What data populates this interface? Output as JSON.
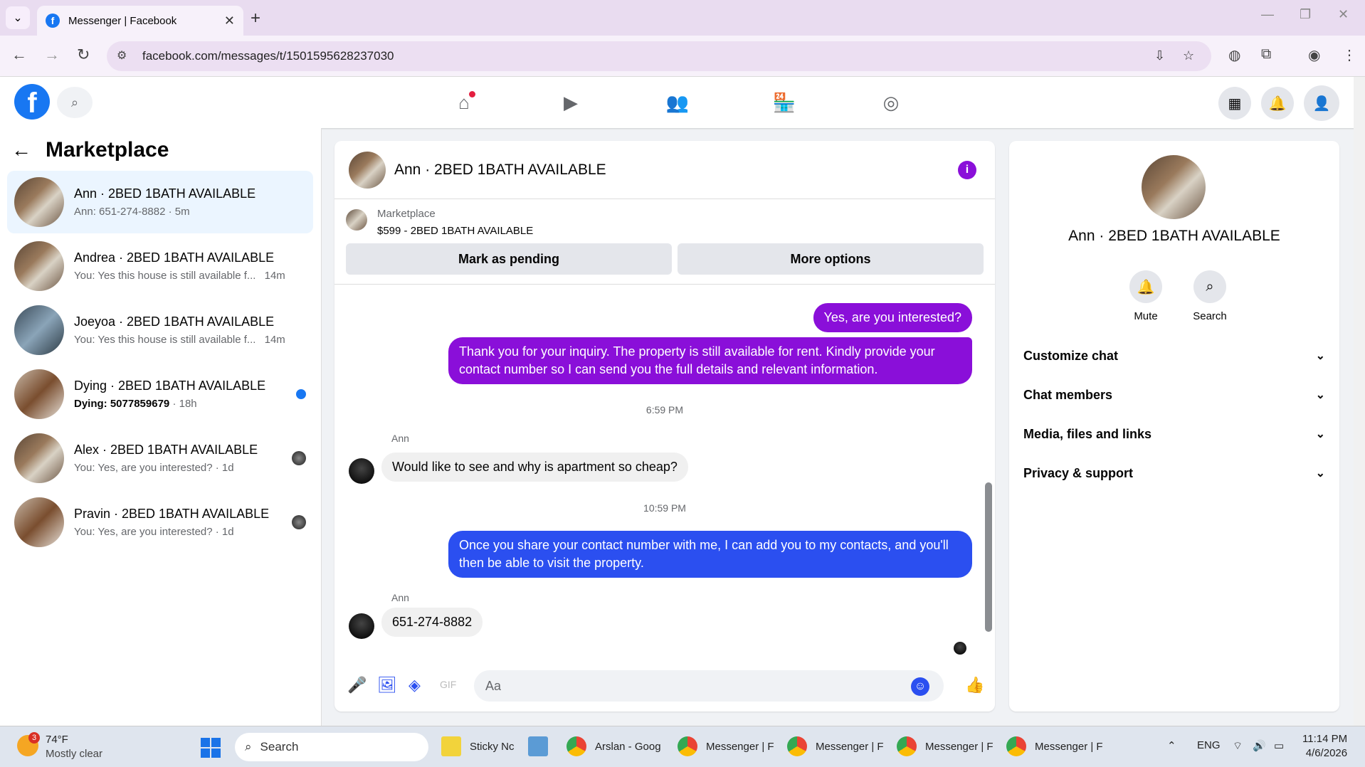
{
  "browser": {
    "tab_title": "Messenger | Facebook",
    "url": "facebook.com/messages/t/1501595628237030"
  },
  "left": {
    "title": "Marketplace",
    "conversations": [
      {
        "name": "Ann · 2BED 1BATH AVAILABLE",
        "sub": "Ann: 651-274-8882 · 5m"
      },
      {
        "name": "Andrea · 2BED 1BATH AVAILABLE",
        "sub": "You: Yes this house is still available f...",
        "time": "14m"
      },
      {
        "name": "Joeyoa · 2BED 1BATH AVAILABLE",
        "sub": "You: Yes this house is still available f...",
        "time": "14m"
      },
      {
        "name": "Dying · 2BED 1BATH AVAILABLE",
        "sub": "Dying: 5077859679",
        "time": "· 18h"
      },
      {
        "name": "Alex · 2BED 1BATH AVAILABLE",
        "sub": "You: Yes, are you interested? · 1d"
      },
      {
        "name": "Pravin · 2BED 1BATH AVAILABLE",
        "sub": "You: Yes, are you interested? · 1d"
      }
    ]
  },
  "chat": {
    "header_name": "Ann · 2BED 1BATH AVAILABLE",
    "marketplace_label": "Marketplace",
    "listing_title": "$599 - 2BED 1BATH AVAILABLE",
    "mark_pending": "Mark as pending",
    "more_options": "More options",
    "messages": {
      "m1": "Yes, are you interested?",
      "m2": "Thank you for your inquiry. The property is still available for rent. Kindly provide your contact number so I can send you the full details and relevant information.",
      "ts1": "6:59 PM",
      "sender1": "Ann",
      "m3": "Would like to see and why is apartment so cheap?",
      "ts2": "10:59 PM",
      "m4": "Once you share your contact number with me, I can add you to my contacts, and you'll then be able to visit the property.",
      "sender2": "Ann",
      "m5": "651-274-8882"
    },
    "composer_placeholder": "Aa"
  },
  "details": {
    "name": "Ann · 2BED 1BATH AVAILABLE",
    "mute": "Mute",
    "search": "Search",
    "sections": [
      "Customize chat",
      "Chat members",
      "Media, files and links",
      "Privacy & support"
    ]
  },
  "taskbar": {
    "temp": "74°F",
    "condition": "Mostly clear",
    "weather_badge": "3",
    "search": "Search",
    "apps": [
      "Sticky Nc",
      "Arslan - Goog",
      "Messenger | F",
      "Messenger | F",
      "Messenger | F",
      "Messenger | F"
    ],
    "lang": "ENG",
    "time": "11:14 PM",
    "date": "4/6/2026"
  },
  "colors": {
    "fb_blue": "#1877f2",
    "outgoing_purple": "#8a0fd9",
    "outgoing_blue": "#2b4ff0"
  }
}
